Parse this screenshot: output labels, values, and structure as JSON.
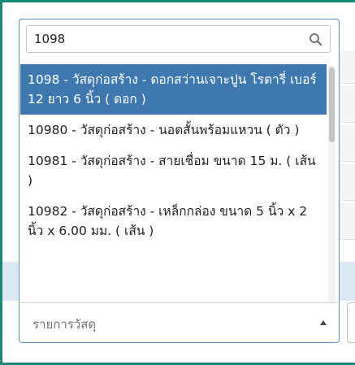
{
  "search": {
    "value": "1098"
  },
  "results": [
    {
      "label": "1098 - วัสดุก่อสร้าง - ดอกสว่านเจาะปูน โรตารี่ เบอร์ 12 ยาว 6 นิ้ว ( ดอก )",
      "selected": true
    },
    {
      "label": "10980 - วัสดุก่อสร้าง - นอตสั้นพร้อมแหวน ( ตัว )",
      "selected": false
    },
    {
      "label": "10981 - วัสดุก่อสร้าง - สายเชื่อม ขนาด 15 ม. ( เส้น )",
      "selected": false
    },
    {
      "label": "10982 - วัสดุก่อสร้าง - เหล็กกล่อง ขนาด 5 นิ้ว x 2 นิ้ว x 6.00 มม. ( เส้น )",
      "selected": false
    }
  ],
  "select": {
    "placeholder": "รายการวัสดุ"
  },
  "colors": {
    "frame": "#1a8a74",
    "selected_bg": "#3f78ae",
    "dropdown_border": "#5a92bd"
  },
  "icons": {
    "search": "search-icon",
    "arrow": "caret-up-icon"
  }
}
